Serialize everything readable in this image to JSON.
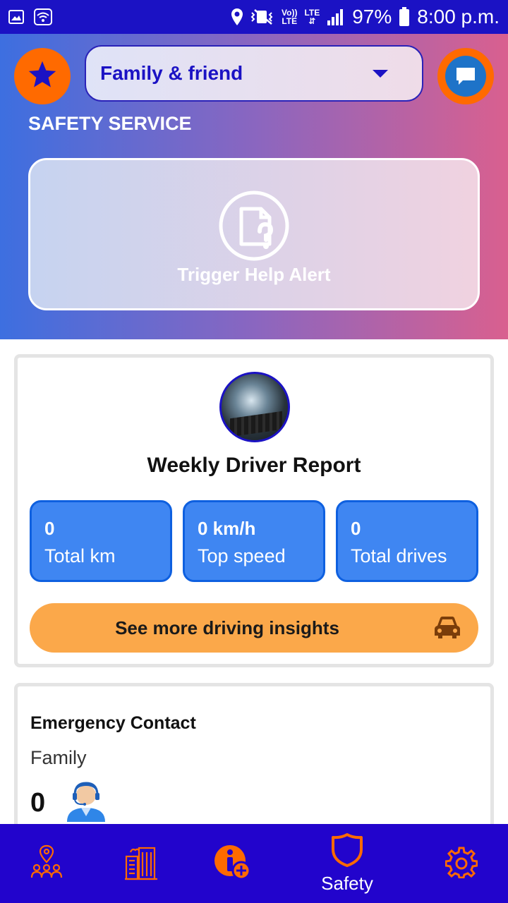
{
  "status_bar": {
    "volte_line1": "Vo))",
    "volte_line2": "LTE",
    "lte": "LTE",
    "battery": "97%",
    "time": "8:00 p.m."
  },
  "header": {
    "group_select": {
      "value": "Family & friend"
    },
    "section_title": "SAFETY SERVICE",
    "help_alert_label": "Trigger Help Alert"
  },
  "report": {
    "title": "Weekly Driver Report",
    "stats": [
      {
        "value": "0",
        "label": "Total km"
      },
      {
        "value": "0 km/h",
        "label": "Top speed"
      },
      {
        "value": "0",
        "label": "Total drives"
      }
    ],
    "insights_label": "See more driving insights"
  },
  "emergency": {
    "title": "Emergency Contact",
    "subtitle": "Family",
    "count": "0"
  },
  "bottom_nav": {
    "items": [
      {
        "icon": "people-location-icon",
        "label": ""
      },
      {
        "icon": "buildings-icon",
        "label": ""
      },
      {
        "icon": "info-add-icon",
        "label": ""
      },
      {
        "icon": "shield-icon",
        "label": "Safety"
      },
      {
        "icon": "gear-icon",
        "label": ""
      }
    ]
  },
  "colors": {
    "primary": "#1b12c4",
    "accent": "#ff6a00",
    "stat_blue": "#3f86f2",
    "insights": "#fba84a",
    "nav_bg": "#2204cc"
  }
}
